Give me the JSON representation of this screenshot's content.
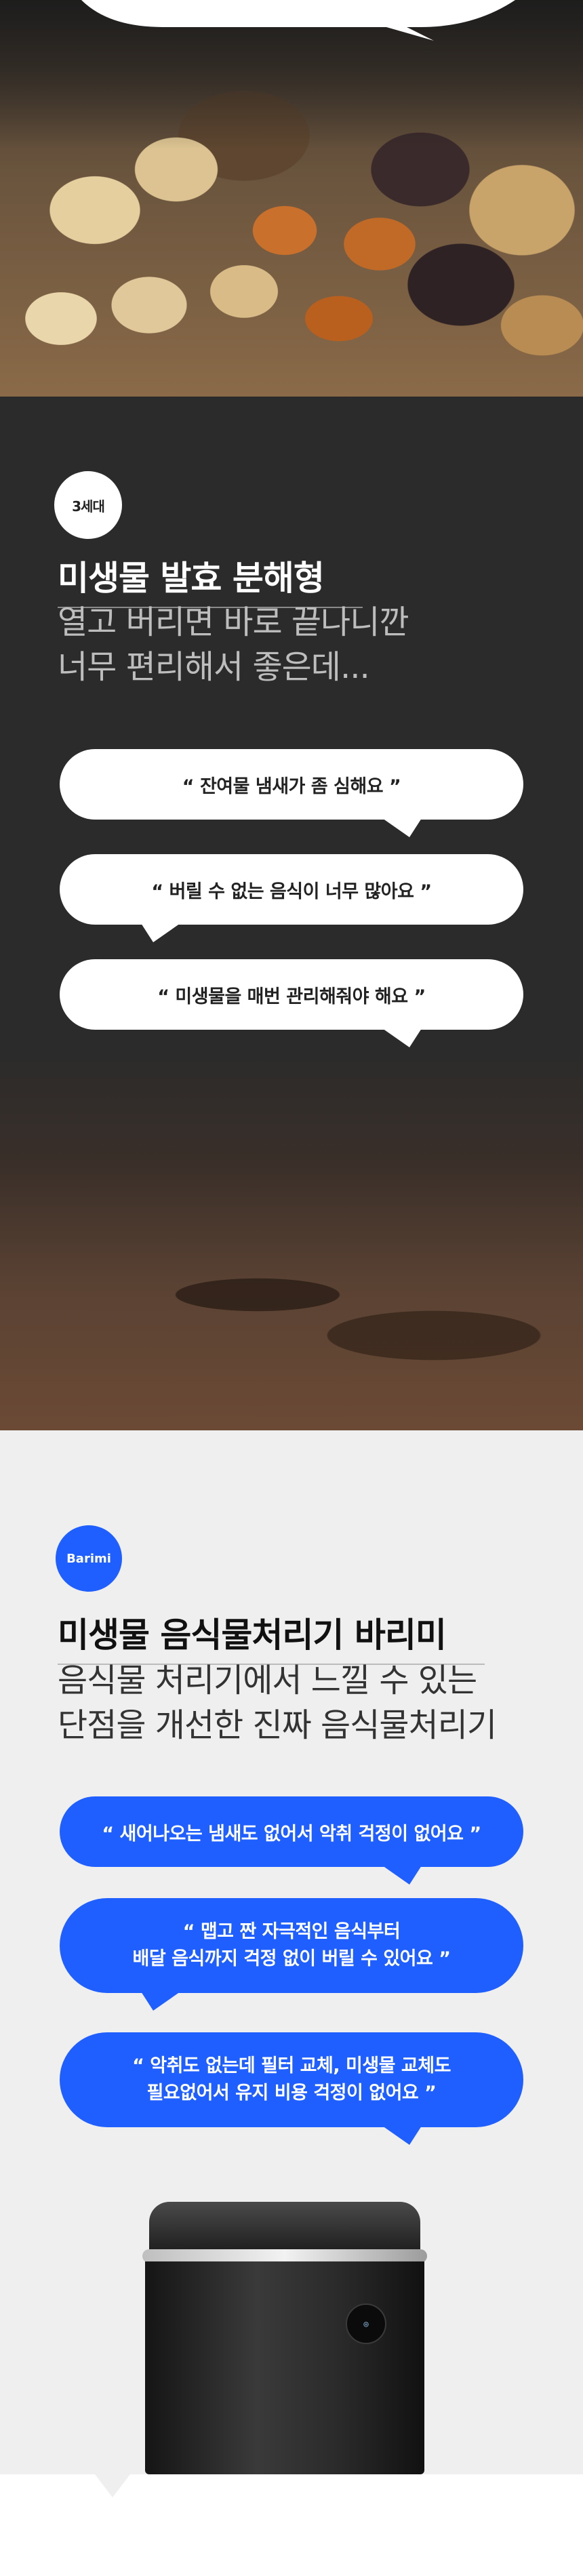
{
  "top_section": {
    "image": "dried-fruit-photo"
  },
  "third_gen": {
    "badge": "3세대",
    "title": "미생물 발효 분해형",
    "subtitle_lines": [
      "열고 버리면 바로 끝나니깐",
      "너무 편리해서 좋은데..."
    ],
    "complaints": [
      "“ 잔여물 냄새가 좀 심해요 ”",
      "“ 버릴 수 없는 음식이 너무 많아요 ”",
      "“ 미생물을 매번 관리해줘야 해요 ”"
    ]
  },
  "barimi": {
    "badge": "Barimi",
    "title": "미생물 음식물처리기 바리미",
    "subtitle_lines": [
      "음식물 처리기에서 느낄 수 있는",
      "단점을 개선한 진짜 음식물처리기"
    ],
    "benefits": [
      {
        "lines": [
          "“ 새어나오는 냄새도 없어서 악취 걱정이 없어요 ”"
        ]
      },
      {
        "lines": [
          "“ 맵고 짠 자극적인 음식부터",
          "배달 음식까지 걱정 없이 버릴 수 있어요 ”"
        ]
      },
      {
        "lines": [
          "“ 악취도 없는데 필터 교체, 미생물 교체도",
          "필요없어서 유지 비용 걱정이 없어요 ”"
        ]
      }
    ],
    "product_image": "food-waste-disposer-product"
  },
  "colors": {
    "dark_bg": "#2b2b2b",
    "light_bg": "#efefef",
    "accent_blue": "#1f5fff",
    "white": "#ffffff"
  }
}
